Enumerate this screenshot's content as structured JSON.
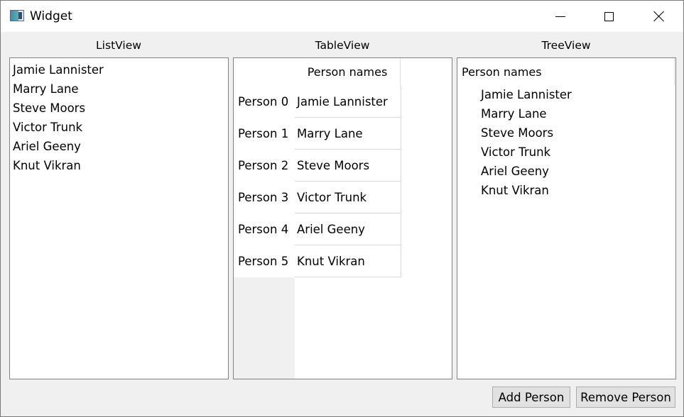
{
  "window": {
    "title": "Widget"
  },
  "list_view": {
    "label": "ListView",
    "items": [
      "Jamie Lannister",
      "Marry Lane",
      "Steve Moors",
      "Victor Trunk",
      "Ariel Geeny",
      "Knut Vikran"
    ]
  },
  "table_view": {
    "label": "TableView",
    "column_header": "Person names",
    "row_headers": [
      "Person 0",
      "Person 1",
      "Person 2",
      "Person 3",
      "Person 4",
      "Person 5"
    ],
    "cells": [
      "Jamie Lannister",
      "Marry Lane",
      "Steve Moors",
      "Victor Trunk",
      "Ariel Geeny",
      "Knut Vikran"
    ]
  },
  "tree_view": {
    "label": "TreeView",
    "column_header": "Person names",
    "items": [
      "Jamie Lannister",
      "Marry Lane",
      "Steve Moors",
      "Victor Trunk",
      "Ariel Geeny",
      "Knut Vikran"
    ]
  },
  "buttons": {
    "add": "Add Person",
    "remove": "Remove Person"
  }
}
